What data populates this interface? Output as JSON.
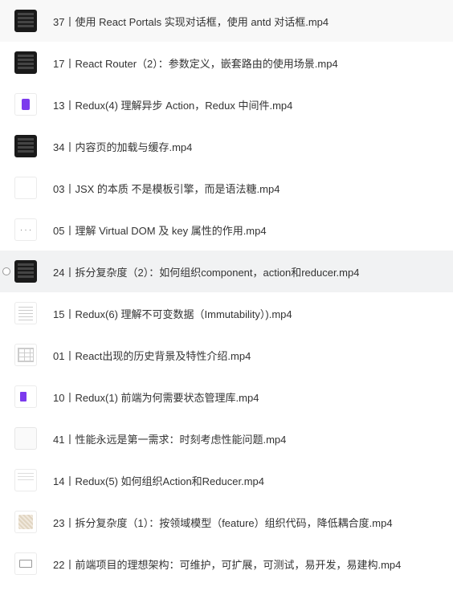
{
  "files": [
    {
      "name": "37丨使用 React Portals 实现对话框，使用 antd 对话框.mp4",
      "thumbType": "dark",
      "selected": false
    },
    {
      "name": "17丨React Router（2）：参数定义，嵌套路由的使用场景.mp4",
      "thumbType": "dark",
      "selected": false
    },
    {
      "name": "13丨Redux(4) 理解异步 Action，Redux 中间件.mp4",
      "thumbType": "purple-icon",
      "selected": false
    },
    {
      "name": "34丨内容页的加载与缓存.mp4",
      "thumbType": "dark",
      "selected": false
    },
    {
      "name": "03丨JSX 的本质 不是模板引擎，而是语法糖.mp4",
      "thumbType": "split-thumb",
      "selected": false
    },
    {
      "name": "05丨理解 Virtual DOM 及 key 属性的作用.mp4",
      "thumbType": "dots-thumb",
      "selected": false
    },
    {
      "name": "24丨拆分复杂度（2）：如何组织component，action和reducer.mp4",
      "thumbType": "dark",
      "selected": true
    },
    {
      "name": "15丨Redux(6) 理解不可变数据（Immutability）).mp4",
      "thumbType": "text-lines",
      "selected": false
    },
    {
      "name": "01丨React出现的历史背景及特性介绍.mp4",
      "thumbType": "table-thumb",
      "selected": false
    },
    {
      "name": "10丨Redux(1) 前端为何需要状态管理库.mp4",
      "thumbType": "single-purple",
      "selected": false
    },
    {
      "name": "41丨性能永远是第一需求：时刻考虑性能问题.mp4",
      "thumbType": "blank",
      "selected": false
    },
    {
      "name": "14丨Redux(5) 如何组织Action和Reducer.mp4",
      "thumbType": "light-box",
      "selected": false
    },
    {
      "name": "23丨拆分复杂度（1）：按领域模型（feature）组织代码，降低耦合度.mp4",
      "thumbType": "pattern",
      "selected": false
    },
    {
      "name": "22丨前端项目的理想架构：可维护，可扩展，可测试，易开发，易建构.mp4",
      "thumbType": "diagram",
      "selected": false
    }
  ]
}
